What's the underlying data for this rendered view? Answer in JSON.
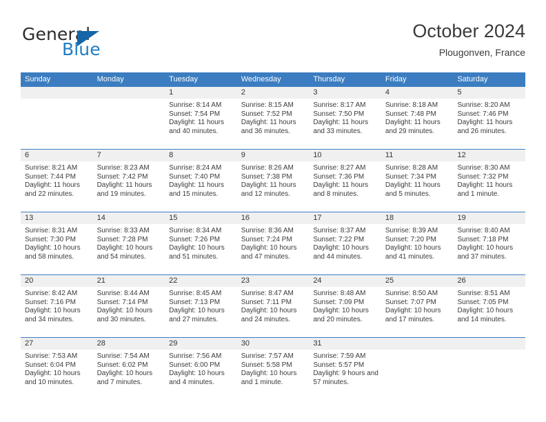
{
  "brand": {
    "name_part1": "General",
    "name_part2": "Blue",
    "accent_color": "#1f7dc4",
    "triangle_color": "#1565a8",
    "logo_icon": "triangle-icon"
  },
  "header": {
    "title": "October 2024",
    "subtitle": "Plougonven, France"
  },
  "theme": {
    "header_bg": "#3b7dc0",
    "day_band_bg": "#f0f0f0",
    "row_divider": "#3b7dc0"
  },
  "weekdays": [
    "Sunday",
    "Monday",
    "Tuesday",
    "Wednesday",
    "Thursday",
    "Friday",
    "Saturday"
  ],
  "weeks": [
    [
      {
        "day": "",
        "sunrise": "",
        "sunset": "",
        "daylight": "",
        "empty": true
      },
      {
        "day": "",
        "sunrise": "",
        "sunset": "",
        "daylight": "",
        "empty": true
      },
      {
        "day": "1",
        "sunrise": "Sunrise: 8:14 AM",
        "sunset": "Sunset: 7:54 PM",
        "daylight": "Daylight: 11 hours and 40 minutes."
      },
      {
        "day": "2",
        "sunrise": "Sunrise: 8:15 AM",
        "sunset": "Sunset: 7:52 PM",
        "daylight": "Daylight: 11 hours and 36 minutes."
      },
      {
        "day": "3",
        "sunrise": "Sunrise: 8:17 AM",
        "sunset": "Sunset: 7:50 PM",
        "daylight": "Daylight: 11 hours and 33 minutes."
      },
      {
        "day": "4",
        "sunrise": "Sunrise: 8:18 AM",
        "sunset": "Sunset: 7:48 PM",
        "daylight": "Daylight: 11 hours and 29 minutes."
      },
      {
        "day": "5",
        "sunrise": "Sunrise: 8:20 AM",
        "sunset": "Sunset: 7:46 PM",
        "daylight": "Daylight: 11 hours and 26 minutes."
      }
    ],
    [
      {
        "day": "6",
        "sunrise": "Sunrise: 8:21 AM",
        "sunset": "Sunset: 7:44 PM",
        "daylight": "Daylight: 11 hours and 22 minutes."
      },
      {
        "day": "7",
        "sunrise": "Sunrise: 8:23 AM",
        "sunset": "Sunset: 7:42 PM",
        "daylight": "Daylight: 11 hours and 19 minutes."
      },
      {
        "day": "8",
        "sunrise": "Sunrise: 8:24 AM",
        "sunset": "Sunset: 7:40 PM",
        "daylight": "Daylight: 11 hours and 15 minutes."
      },
      {
        "day": "9",
        "sunrise": "Sunrise: 8:26 AM",
        "sunset": "Sunset: 7:38 PM",
        "daylight": "Daylight: 11 hours and 12 minutes."
      },
      {
        "day": "10",
        "sunrise": "Sunrise: 8:27 AM",
        "sunset": "Sunset: 7:36 PM",
        "daylight": "Daylight: 11 hours and 8 minutes."
      },
      {
        "day": "11",
        "sunrise": "Sunrise: 8:28 AM",
        "sunset": "Sunset: 7:34 PM",
        "daylight": "Daylight: 11 hours and 5 minutes."
      },
      {
        "day": "12",
        "sunrise": "Sunrise: 8:30 AM",
        "sunset": "Sunset: 7:32 PM",
        "daylight": "Daylight: 11 hours and 1 minute."
      }
    ],
    [
      {
        "day": "13",
        "sunrise": "Sunrise: 8:31 AM",
        "sunset": "Sunset: 7:30 PM",
        "daylight": "Daylight: 10 hours and 58 minutes."
      },
      {
        "day": "14",
        "sunrise": "Sunrise: 8:33 AM",
        "sunset": "Sunset: 7:28 PM",
        "daylight": "Daylight: 10 hours and 54 minutes."
      },
      {
        "day": "15",
        "sunrise": "Sunrise: 8:34 AM",
        "sunset": "Sunset: 7:26 PM",
        "daylight": "Daylight: 10 hours and 51 minutes."
      },
      {
        "day": "16",
        "sunrise": "Sunrise: 8:36 AM",
        "sunset": "Sunset: 7:24 PM",
        "daylight": "Daylight: 10 hours and 47 minutes."
      },
      {
        "day": "17",
        "sunrise": "Sunrise: 8:37 AM",
        "sunset": "Sunset: 7:22 PM",
        "daylight": "Daylight: 10 hours and 44 minutes."
      },
      {
        "day": "18",
        "sunrise": "Sunrise: 8:39 AM",
        "sunset": "Sunset: 7:20 PM",
        "daylight": "Daylight: 10 hours and 41 minutes."
      },
      {
        "day": "19",
        "sunrise": "Sunrise: 8:40 AM",
        "sunset": "Sunset: 7:18 PM",
        "daylight": "Daylight: 10 hours and 37 minutes."
      }
    ],
    [
      {
        "day": "20",
        "sunrise": "Sunrise: 8:42 AM",
        "sunset": "Sunset: 7:16 PM",
        "daylight": "Daylight: 10 hours and 34 minutes."
      },
      {
        "day": "21",
        "sunrise": "Sunrise: 8:44 AM",
        "sunset": "Sunset: 7:14 PM",
        "daylight": "Daylight: 10 hours and 30 minutes."
      },
      {
        "day": "22",
        "sunrise": "Sunrise: 8:45 AM",
        "sunset": "Sunset: 7:13 PM",
        "daylight": "Daylight: 10 hours and 27 minutes."
      },
      {
        "day": "23",
        "sunrise": "Sunrise: 8:47 AM",
        "sunset": "Sunset: 7:11 PM",
        "daylight": "Daylight: 10 hours and 24 minutes."
      },
      {
        "day": "24",
        "sunrise": "Sunrise: 8:48 AM",
        "sunset": "Sunset: 7:09 PM",
        "daylight": "Daylight: 10 hours and 20 minutes."
      },
      {
        "day": "25",
        "sunrise": "Sunrise: 8:50 AM",
        "sunset": "Sunset: 7:07 PM",
        "daylight": "Daylight: 10 hours and 17 minutes."
      },
      {
        "day": "26",
        "sunrise": "Sunrise: 8:51 AM",
        "sunset": "Sunset: 7:05 PM",
        "daylight": "Daylight: 10 hours and 14 minutes."
      }
    ],
    [
      {
        "day": "27",
        "sunrise": "Sunrise: 7:53 AM",
        "sunset": "Sunset: 6:04 PM",
        "daylight": "Daylight: 10 hours and 10 minutes."
      },
      {
        "day": "28",
        "sunrise": "Sunrise: 7:54 AM",
        "sunset": "Sunset: 6:02 PM",
        "daylight": "Daylight: 10 hours and 7 minutes."
      },
      {
        "day": "29",
        "sunrise": "Sunrise: 7:56 AM",
        "sunset": "Sunset: 6:00 PM",
        "daylight": "Daylight: 10 hours and 4 minutes."
      },
      {
        "day": "30",
        "sunrise": "Sunrise: 7:57 AM",
        "sunset": "Sunset: 5:58 PM",
        "daylight": "Daylight: 10 hours and 1 minute."
      },
      {
        "day": "31",
        "sunrise": "Sunrise: 7:59 AM",
        "sunset": "Sunset: 5:57 PM",
        "daylight": "Daylight: 9 hours and 57 minutes."
      },
      {
        "day": "",
        "sunrise": "",
        "sunset": "",
        "daylight": "",
        "empty": true
      },
      {
        "day": "",
        "sunrise": "",
        "sunset": "",
        "daylight": "",
        "empty": true
      }
    ]
  ]
}
